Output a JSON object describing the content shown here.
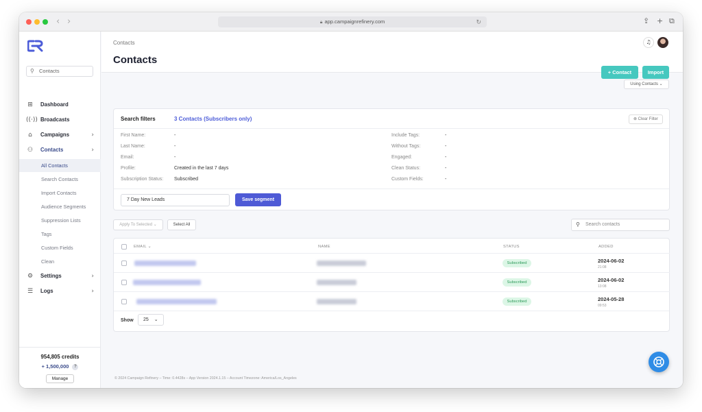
{
  "browser": {
    "url": "app.campaignrefinery.com",
    "colors": {
      "close": "#fe5f57",
      "minimize": "#febc2e",
      "zoom": "#28c840"
    }
  },
  "sidebar": {
    "search_label": "Contacts",
    "items": [
      {
        "label": "Dashboard",
        "icon": "grid-icon"
      },
      {
        "label": "Broadcasts",
        "icon": "broadcast-icon"
      },
      {
        "label": "Campaigns",
        "icon": "inbox-icon",
        "chevron": "›"
      },
      {
        "label": "Contacts",
        "icon": "user-icon",
        "chevron": "‹"
      }
    ],
    "subitems": [
      "All Contacts",
      "Search Contacts",
      "Import Contacts",
      "Audience Segments",
      "Suppression Lists",
      "Tags",
      "Custom Fields",
      "Clean"
    ],
    "items_bottom": [
      {
        "label": "Settings",
        "icon": "gear-icon",
        "chevron": "›"
      },
      {
        "label": "Logs",
        "icon": "list-icon",
        "chevron": "›"
      }
    ],
    "credits": "954,805 credits",
    "bonus": "+ 1,500,000",
    "help_mark": "?",
    "manage_label": "Manage"
  },
  "header": {
    "breadcrumb": "Contacts",
    "title": "Contacts",
    "add_contact_label": "Contact",
    "import_label": "Import",
    "using_label": "Using Contacts"
  },
  "filters": {
    "title": "Search filters",
    "count_label": "3 Contacts (Subscribers only)",
    "clear_label": "Clear Filter",
    "left": [
      {
        "label": "First Name:",
        "value": "-"
      },
      {
        "label": "Last Name:",
        "value": "-"
      },
      {
        "label": "Email:",
        "value": "-"
      },
      {
        "label": "Profile:",
        "value": "Created in the last 7 days"
      },
      {
        "label": "Subscription Status:",
        "value": "Subscribed"
      }
    ],
    "right": [
      {
        "label": "Include Tags:",
        "value": "-"
      },
      {
        "label": "Without Tags:",
        "value": "-"
      },
      {
        "label": "Engaged:",
        "value": "-"
      },
      {
        "label": "Clean Status:",
        "value": "-"
      },
      {
        "label": "Custom Fields:",
        "value": "-"
      }
    ],
    "segment_name": "7 Day New Leads",
    "save_segment_label": "Save segment"
  },
  "toolbar": {
    "apply_label": "Apply To Selected",
    "select_all_label": "Select All",
    "search_placeholder": "Search contacts"
  },
  "table": {
    "columns": {
      "email": "EMAIL",
      "name": "NAME",
      "status": "STATUS",
      "added": "ADDED"
    },
    "rows": [
      {
        "status": "Subscribed",
        "date": "2024-06-02",
        "time": "21:08"
      },
      {
        "status": "Subscribed",
        "date": "2024-06-02",
        "time": "13:08"
      },
      {
        "status": "Subscribed",
        "date": "2024-05-28",
        "time": "09:53"
      }
    ],
    "show_label": "Show",
    "page_size": "25"
  },
  "footer": "© 2024 Campaign Refinery – Time: 0.4428s – App Version 2024.1.15 – Account Timezone: America/Los_Angeles",
  "colors": {
    "accent": "#4e5ad6",
    "teal": "#46c8bf",
    "subscribed_bg": "#dcf6e6",
    "help": "#2f8ce6"
  }
}
